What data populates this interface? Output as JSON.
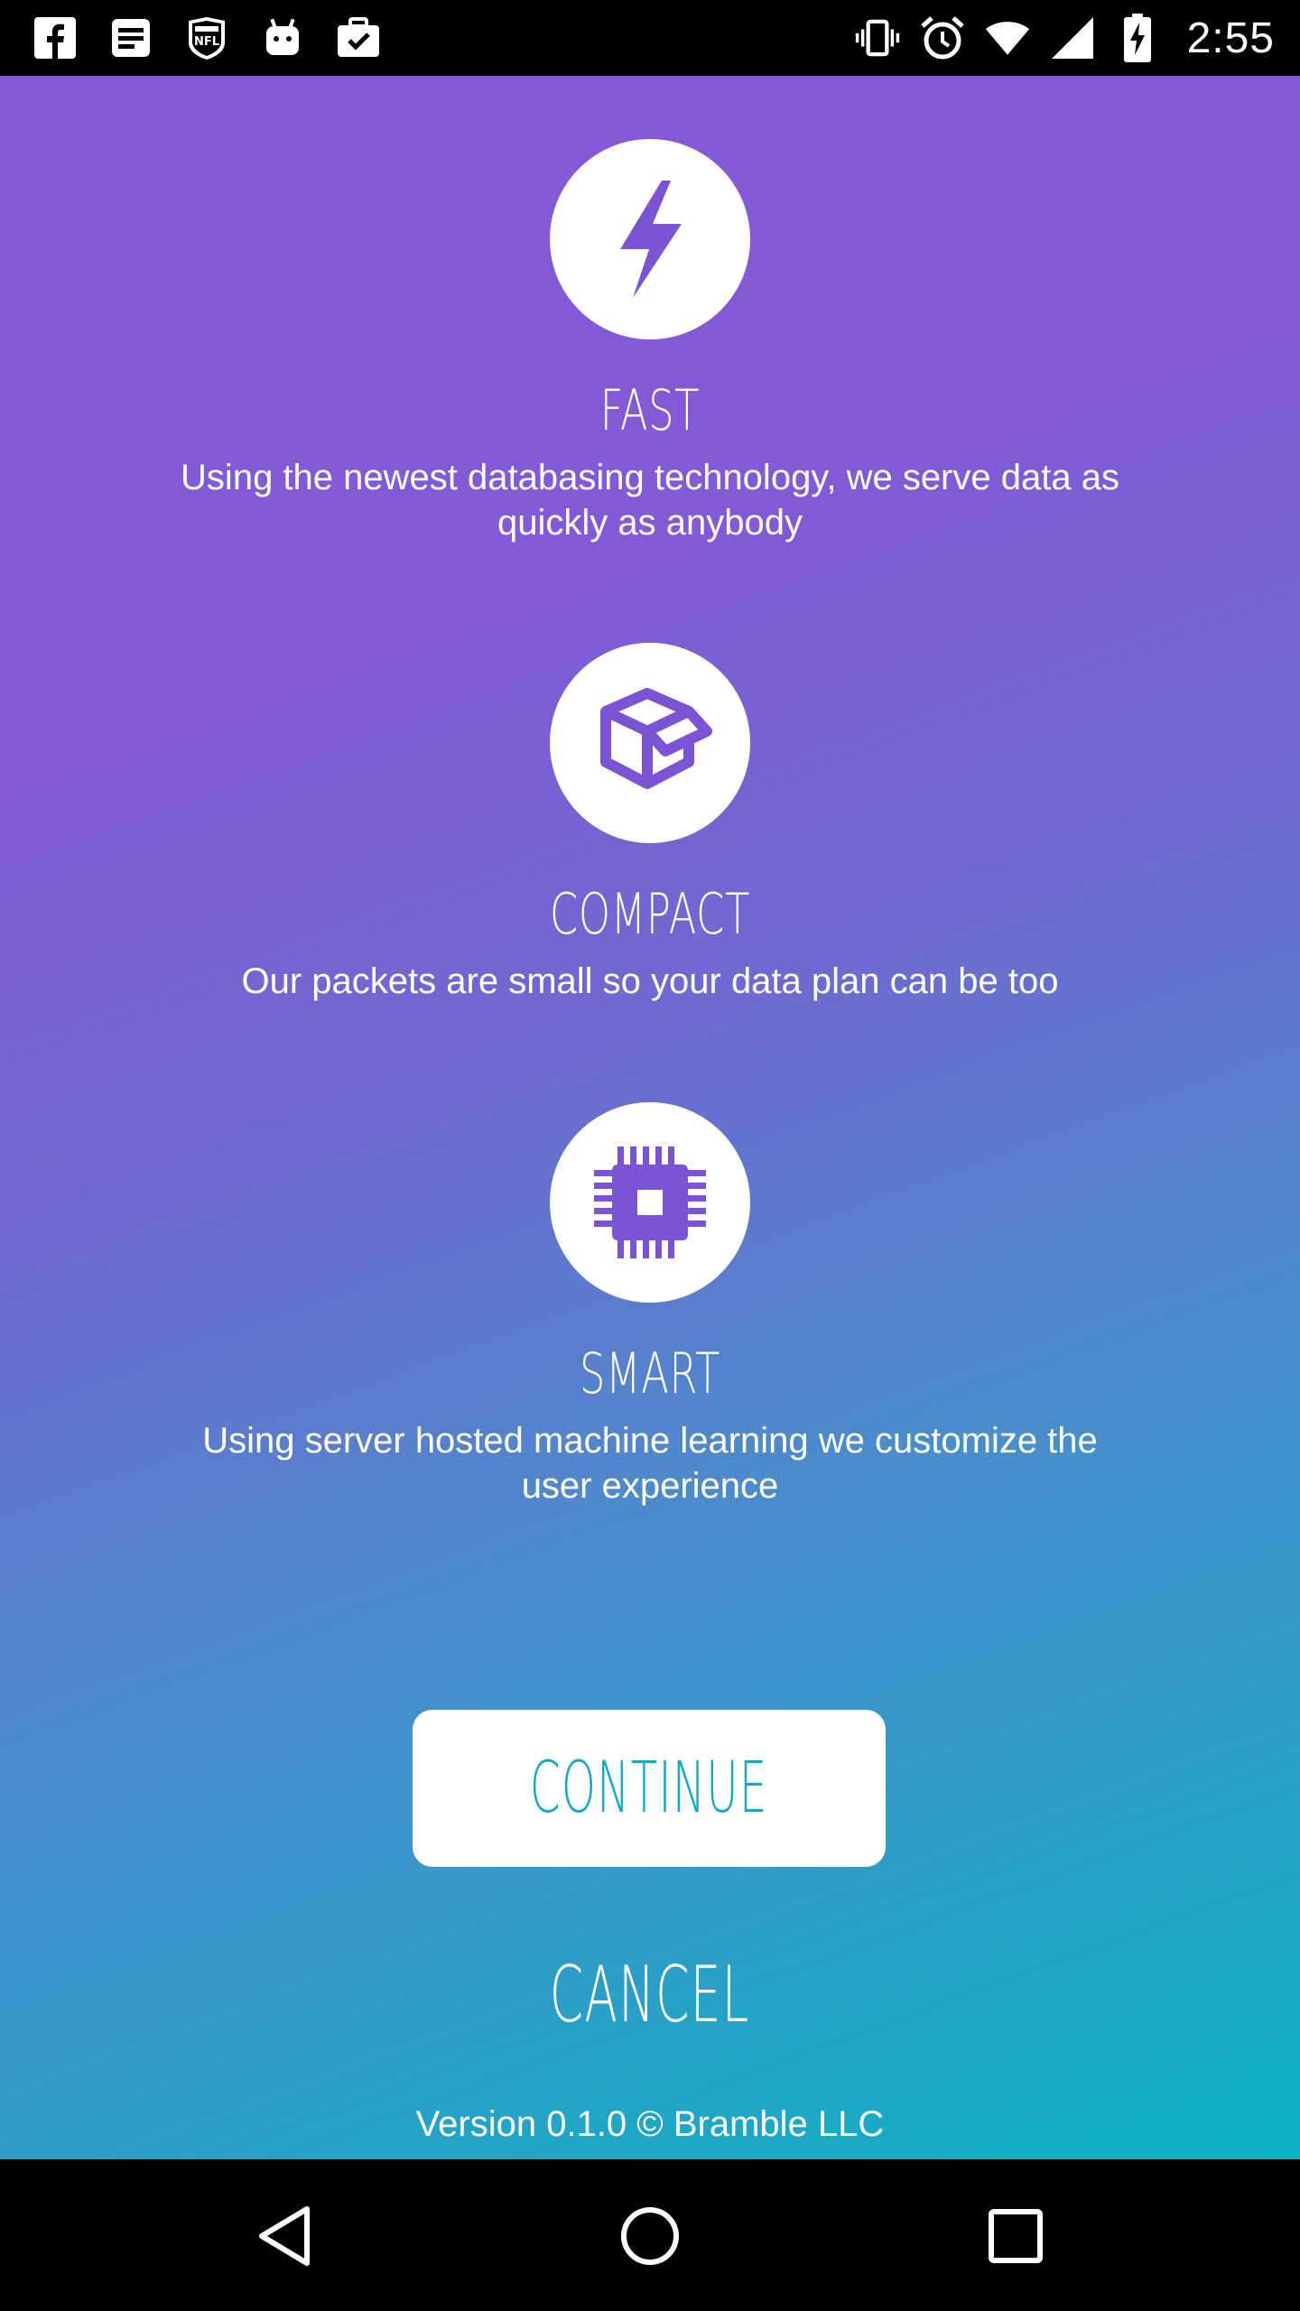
{
  "status_bar": {
    "left_icons": [
      "facebook-icon",
      "news-icon",
      "nfl-icon",
      "android-icon",
      "briefcase-check-icon"
    ],
    "right_icons": [
      "vibrate-icon",
      "alarm-icon",
      "wifi-icon",
      "signal-icon",
      "battery-charging-icon"
    ],
    "time": "2:55"
  },
  "features": [
    {
      "icon": "lightning-icon",
      "title": "FAST",
      "description": "Using the newest databasing technology, we serve data as quickly as anybody"
    },
    {
      "icon": "package-icon",
      "title": "COMPACT",
      "description": "Our packets are small so your data plan can be too"
    },
    {
      "icon": "chip-icon",
      "title": "SMART",
      "description": "Using server hosted machine learning we customize the user experience"
    }
  ],
  "actions": {
    "continue_label": "CONTINUE",
    "cancel_label": "CANCEL"
  },
  "footer": {
    "version": "Version 0.1.0 © Bramble LLC"
  },
  "colors": {
    "gradient_top": "#8259d6",
    "gradient_bottom": "#0bb2c3",
    "accent": "#7a54d4",
    "continue_text": "#12a9c3"
  },
  "nav_bar": {
    "buttons": [
      "back-icon",
      "home-icon",
      "recents-icon"
    ]
  }
}
